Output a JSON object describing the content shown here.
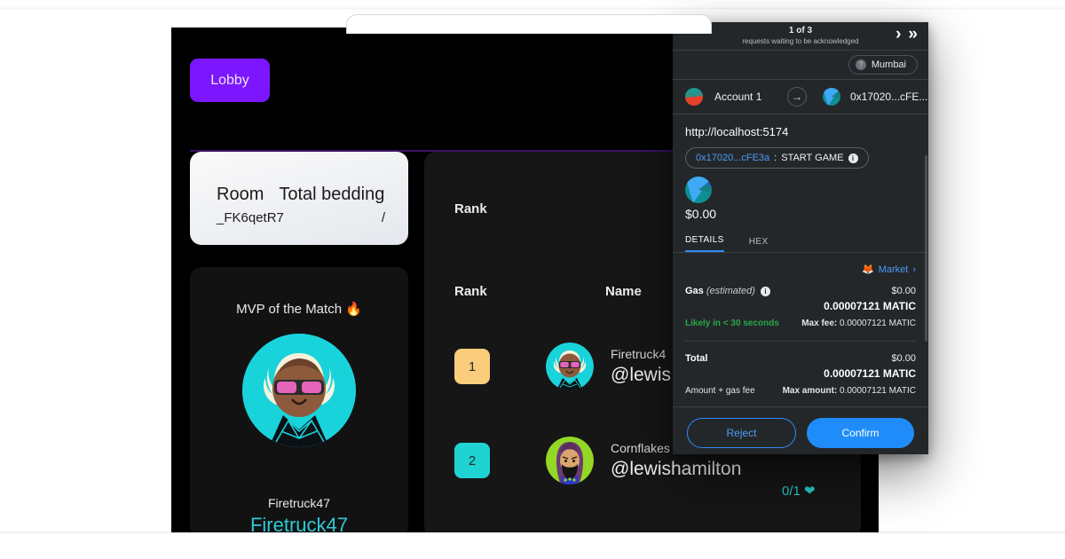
{
  "app": {
    "lobby_button": "Lobby",
    "room_card": {
      "header_room": "Room",
      "header_bedding": "Total bedding",
      "room_value": "_FK6qetR7",
      "bedding_value": "/"
    },
    "mvp_card": {
      "title": "MVP of the Match 🔥",
      "name": "Firetruck47",
      "handle": "Firetruck47"
    },
    "leaderboard": {
      "section_title": "Rank",
      "columns": {
        "rank": "Rank",
        "name": "Name"
      },
      "rows": [
        {
          "rank": "1",
          "name": "Firetruck4",
          "handle": "@lewis",
          "score": ""
        },
        {
          "rank": "2",
          "name": "Cornflakes",
          "handle": "@lewishamilton",
          "score": "0/1 ❤"
        }
      ]
    }
  },
  "metamask": {
    "queue": {
      "count": "1 of 3",
      "text": "requests waiting to be acknowledged",
      "next": "›",
      "last": "»"
    },
    "network": {
      "label": "Mumbai",
      "icon_char": "?"
    },
    "account": {
      "name": "Account 1",
      "arrow": "→",
      "recipient": "0x17020...cFE..."
    },
    "origin": "http://localhost:5174",
    "method_chip": {
      "address": "0x17020...cFE3a",
      "separator": " : ",
      "method": "START GAME",
      "info": "i"
    },
    "token_amount": "$0.00",
    "tabs": [
      {
        "label": "DETAILS",
        "active": true
      },
      {
        "label": "HEX",
        "active": false
      }
    ],
    "market_link": "Market",
    "market_chevron": "›",
    "market_icon": "🦊",
    "gas": {
      "label": "Gas",
      "estimated": "(estimated)",
      "info": "i",
      "fiat": "$0.00",
      "crypto": "0.00007121 MATIC",
      "speed": "Likely in < 30 seconds",
      "max_fee_label": "Max fee:",
      "max_fee_value": "0.00007121 MATIC"
    },
    "total": {
      "label": "Total",
      "fiat": "$0.00",
      "crypto": "0.00007121 MATIC",
      "note": "Amount + gas fee",
      "max_amount_label": "Max amount:",
      "max_amount_value": "0.00007121 MATIC"
    },
    "buttons": {
      "reject": "Reject",
      "confirm": "Confirm"
    }
  },
  "colors": {
    "lobby_purple": "#7c16ff",
    "accent_teal": "#2dc9d6",
    "rank_gold": "#f9cd7c",
    "rank_teal": "#20d3d3",
    "mm_blue": "#1f8cf9",
    "mm_green": "#28a745",
    "mm_bg": "#24272a"
  }
}
